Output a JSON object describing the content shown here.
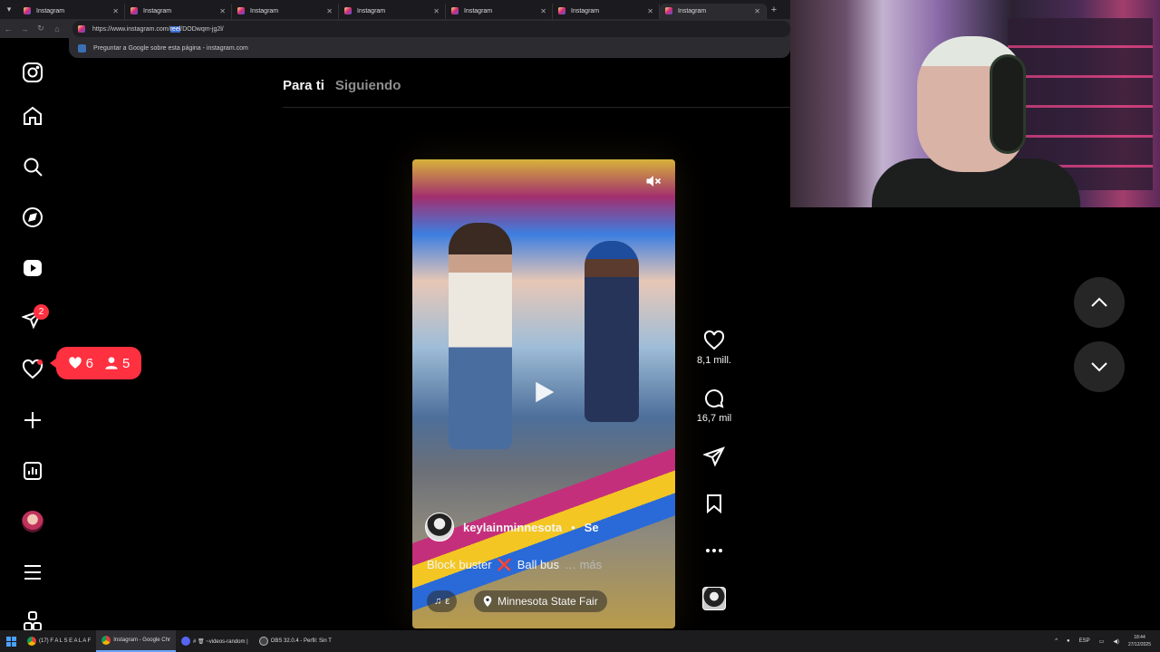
{
  "browser": {
    "tabs": [
      {
        "title": "Instagram",
        "active": false
      },
      {
        "title": "Instagram",
        "active": false
      },
      {
        "title": "Instagram",
        "active": false
      },
      {
        "title": "Instagram",
        "active": false
      },
      {
        "title": "Instagram",
        "active": false
      },
      {
        "title": "Instagram",
        "active": false
      },
      {
        "title": "Instagram",
        "active": true
      }
    ],
    "url_prefix": "https://www.instagram.com/",
    "url_selected": "reel",
    "url_suffix": "/DODwqm-jg2l/",
    "suggestion": "Preguntar a Google sobre esta página - instagram.com"
  },
  "sidebar": {
    "messages_badge": "2",
    "notifications": {
      "likes": "6",
      "follows": "5"
    }
  },
  "feed": {
    "tab_for_you": "Para ti",
    "tab_following": "Siguiendo"
  },
  "reel": {
    "username": "keylainminnesota",
    "separator": "•",
    "follow_partial": "Se",
    "caption_a": "Block buster",
    "caption_x": "❌",
    "caption_b": "Ball bus",
    "caption_more": "… más",
    "audio_text": "ε",
    "location": "Minnesota State Fair",
    "likes": "8,1 mill.",
    "comments": "16,7 mil"
  },
  "taskbar": {
    "items": [
      {
        "label": "(17) F A L S E A L A F",
        "active": false
      },
      {
        "label": "Instagram - Google Chr",
        "active": true
      },
      {
        "label": "# 🗑 ~videos-random | ",
        "active": false
      },
      {
        "label": "OBS 32.0.4 - Perfil: Sin T",
        "active": false
      }
    ],
    "language": "ESP",
    "time": "18:44",
    "date": "27/12/2025"
  },
  "colors": {
    "accent_red": "#ff3040",
    "background": "#000000",
    "muted_text": "#8e8e8e"
  }
}
